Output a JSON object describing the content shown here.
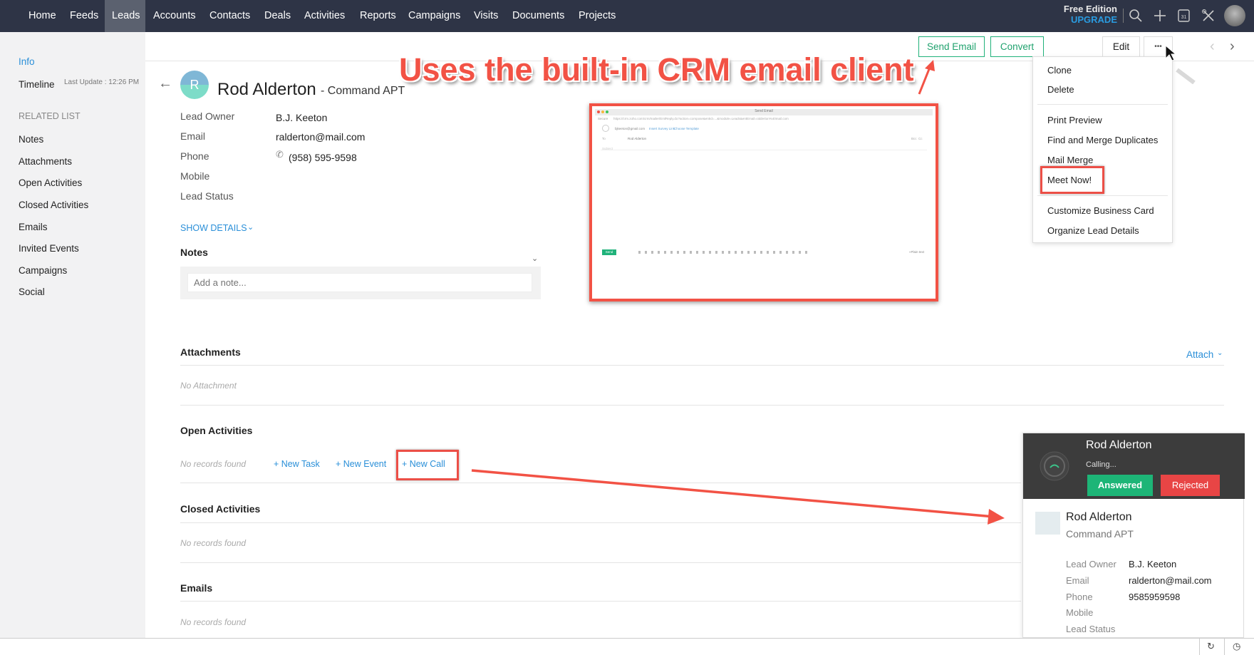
{
  "nav": {
    "items": [
      "Home",
      "Feeds",
      "Leads",
      "Accounts",
      "Contacts",
      "Deals",
      "Activities",
      "Reports",
      "Campaigns",
      "Visits",
      "Documents",
      "Projects"
    ],
    "active": "Leads",
    "edition": "Free Edition",
    "upgrade": "UPGRADE",
    "calendar_day": "31"
  },
  "sidebar": {
    "info": "Info",
    "timeline": "Timeline",
    "last_update": "Last Update : 12:26 PM",
    "related_heading": "RELATED LIST",
    "items": [
      "Notes",
      "Attachments",
      "Open Activities",
      "Closed Activities",
      "Emails",
      "Invited Events",
      "Campaigns",
      "Social"
    ]
  },
  "toolbar": {
    "send_email": "Send Email",
    "convert": "Convert",
    "edit": "Edit",
    "more": "•••"
  },
  "menu": {
    "items": [
      "Clone",
      "Delete",
      "Print Preview",
      "Find and Merge Duplicates",
      "Mail Merge",
      "Meet Now!",
      "Customize Business Card",
      "Organize Lead Details"
    ]
  },
  "lead": {
    "avatar_letter": "R",
    "name": "Rod Alderton",
    "company": "- Command APT",
    "fields": [
      {
        "label": "Lead Owner",
        "value": "B.J. Keeton"
      },
      {
        "label": "Email",
        "value": "ralderton@mail.com"
      },
      {
        "label": "Phone",
        "value": "(958) 595-9598"
      },
      {
        "label": "Mobile",
        "value": ""
      },
      {
        "label": "Lead Status",
        "value": ""
      }
    ],
    "show_details": "SHOW DETAILS"
  },
  "notes": {
    "title": "Notes",
    "placeholder": "Add a note..."
  },
  "attachments": {
    "title": "Attachments",
    "attach": "Attach",
    "empty": "No Attachment"
  },
  "open_activities": {
    "title": "Open Activities",
    "empty": "No records found",
    "new_task": "+ New Task",
    "new_event": "+ New Event",
    "new_call": "+ New Call"
  },
  "closed_activities": {
    "title": "Closed Activities",
    "empty": "No records found"
  },
  "emails": {
    "title": "Emails",
    "empty": "No records found"
  },
  "annotation": "Uses the built-in CRM email client",
  "email_preview": {
    "window_title": "Send Email",
    "secure": "Secure",
    "url": "https://crm.zoho.com/crm/mailer/EmlReply.do?action=compose&entId=...&module=Leads&entEmail=ralderton%40mail.com",
    "from": "bjkeeton@gmail.com",
    "insert_survey": "Insert Survey Link",
    "choose_template": "Choose Template",
    "to_label": "To",
    "to_value": "Rod Alderton",
    "bcc": "Bcc",
    "cc": "Cc",
    "subject": "Subject",
    "send": "Send",
    "plain_text": "«Plain text"
  },
  "call": {
    "name": "Rod Alderton",
    "status": "Calling...",
    "answered": "Answered",
    "rejected": "Rejected",
    "company": "Command APT",
    "fields": [
      {
        "label": "Lead Owner",
        "value": "B.J. Keeton"
      },
      {
        "label": "Email",
        "value": "ralderton@mail.com"
      },
      {
        "label": "Phone",
        "value": "9585959598"
      },
      {
        "label": "Mobile",
        "value": ""
      },
      {
        "label": "Lead Status",
        "value": ""
      }
    ]
  },
  "colors": {
    "nav_bg": "#2e3446",
    "accent_green": "#20b27a",
    "accent_blue": "#2a8fd8",
    "annotation_red": "#f25245",
    "reject_red": "#e84545"
  }
}
